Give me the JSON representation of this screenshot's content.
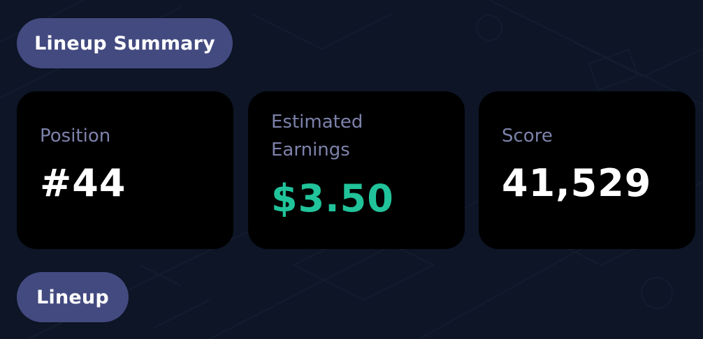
{
  "sections": {
    "summary_label": "Lineup Summary",
    "lineup_label": "Lineup"
  },
  "stats": [
    {
      "label": "Position",
      "value": "#44"
    },
    {
      "label": "Estimated Earnings",
      "value": "$3.50"
    },
    {
      "label": "Score",
      "value": "41,529"
    }
  ],
  "colors": {
    "background": "#0d1526",
    "pill": "#434a80",
    "card": "#000000",
    "label": "#7d82ab",
    "earnings_accent": "#21c39a",
    "value": "#ffffff"
  }
}
